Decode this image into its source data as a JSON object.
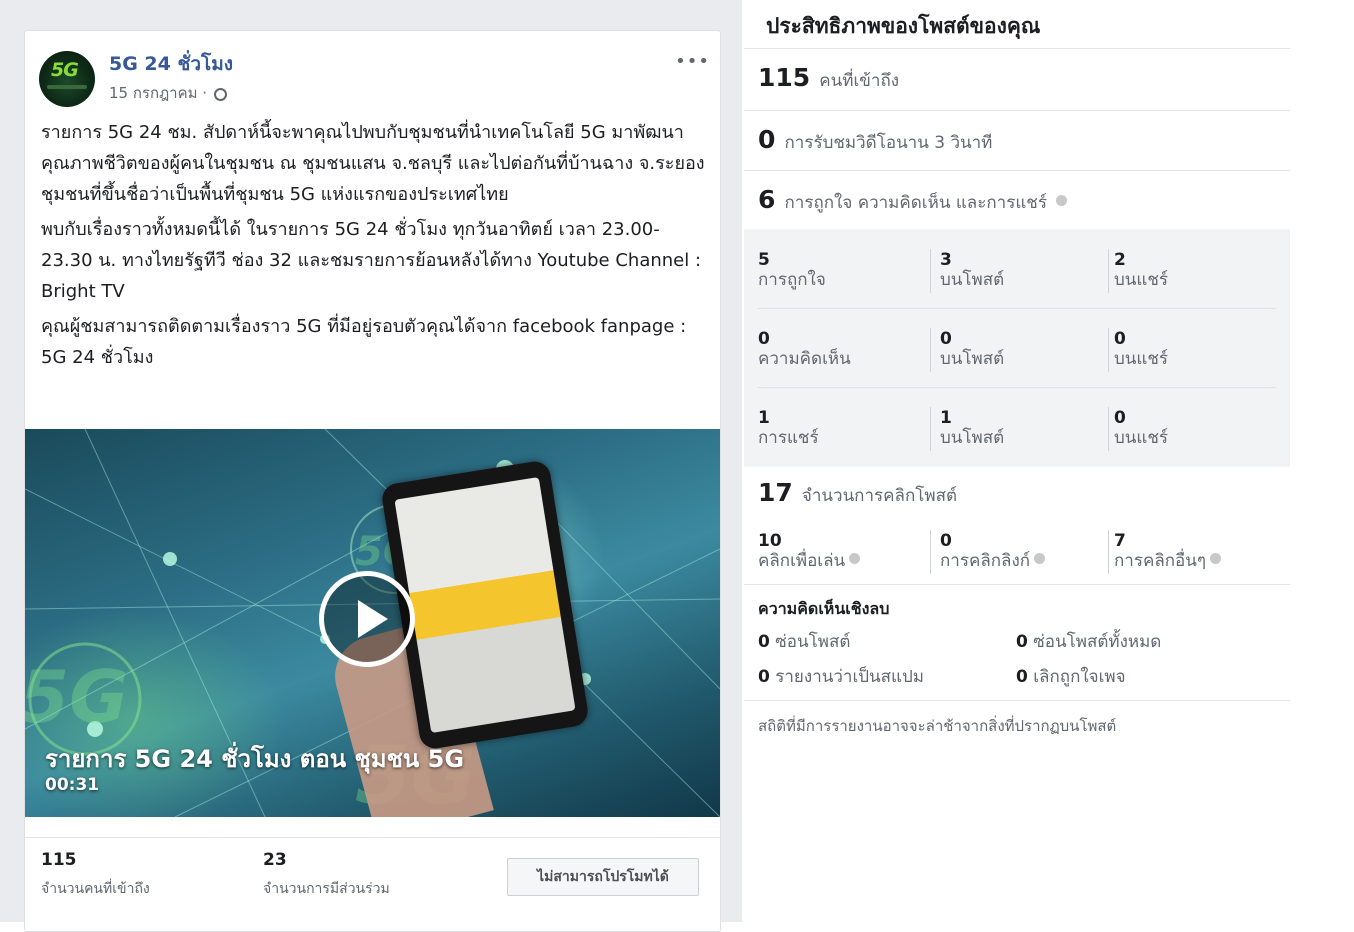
{
  "post": {
    "page_name": "5G 24 ชั่วโมง",
    "avatar_text": "5G",
    "date": "15 กรกฎาคม ·",
    "more": "•••",
    "paragraphs": [
      "รายการ 5G 24 ชม. สัปดาห์นี้จะพาคุณไปพบกับชุมชนที่นำเทคโนโลยี 5G มาพัฒนาคุณภาพชีวิตของผู้คนในชุมชน ณ ชุมชนแสน จ.ชลบุรี และไปต่อกันที่บ้านฉาง จ.ระยอง ชุมชนที่ขึ้นชื่อว่าเป็นพื้นที่ชุมชน 5G แห่งแรกของประเทศไทย",
      "พบกับเรื่องราวทั้งหมดนี้ได้ ในรายการ 5G 24 ชั่วโมง ทุกวันอาทิตย์ เวลา 23.00-23.30 น. ทางไทยรัฐทีวี ช่อง 32 และชมรายการย้อนหลังได้ทาง Youtube Channel : Bright TV",
      "คุณผู้ชมสามารถติดตามเรื่องราว 5G ที่มีอยู่รอบตัวคุณได้จาก facebook fanpage : 5G 24 ชั่วโมง"
    ],
    "video": {
      "title": "รายการ 5G 24 ชั่วโมง ตอน ชุมชน 5G",
      "duration": "00:31"
    },
    "stats": {
      "reach_value": "115",
      "reach_label": "จำนวนคนที่เข้าถึง",
      "engagement_value": "23",
      "engagement_label": "จำนวนการมีส่วนร่วม",
      "promote_button": "ไม่สามารถโปรโมทได้"
    }
  },
  "panel": {
    "title": "ประสิทธิภาพของโพสต์ของคุณ",
    "reach": {
      "value": "115",
      "label": "คนที่เข้าถึง"
    },
    "views": {
      "value": "0",
      "label": "การรับชมวิดีโอนาน 3 วินาที"
    },
    "reactions": {
      "value": "6",
      "label": "การถูกใจ ความคิดเห็น และการแชร์"
    },
    "breakdown": [
      {
        "total": "5",
        "total_label": "การถูกใจ",
        "on_post": "3",
        "on_post_label": "บนโพสต์",
        "on_share": "2",
        "on_share_label": "บนแชร์"
      },
      {
        "total": "0",
        "total_label": "ความคิดเห็น",
        "on_post": "0",
        "on_post_label": "บนโพสต์",
        "on_share": "0",
        "on_share_label": "บนแชร์"
      },
      {
        "total": "1",
        "total_label": "การแชร์",
        "on_post": "1",
        "on_post_label": "บนโพสต์",
        "on_share": "0",
        "on_share_label": "บนแชร์"
      }
    ],
    "clicks": {
      "value": "17",
      "label": "จำนวนการคลิกโพสต์"
    },
    "click_breakdown": [
      {
        "value": "10",
        "label": "คลิกเพื่อเล่น"
      },
      {
        "value": "0",
        "label": "การคลิกลิงก์"
      },
      {
        "value": "7",
        "label": "การคลิกอื่นๆ"
      }
    ],
    "negative": {
      "title": "ความคิดเห็นเชิงลบ",
      "hide_post": {
        "value": "0",
        "label": "ซ่อนโพสต์"
      },
      "hide_all": {
        "value": "0",
        "label": "ซ่อนโพสต์ทั้งหมด"
      },
      "report_spam": {
        "value": "0",
        "label": "รายงานว่าเป็นสแปม"
      },
      "unlike_page": {
        "value": "0",
        "label": "เลิกถูกใจเพจ"
      }
    },
    "footnote": "สถิติที่มีการรายงานอาจจะล่าช้าจากสิ่งที่ปรากฏบนโพสต์"
  }
}
